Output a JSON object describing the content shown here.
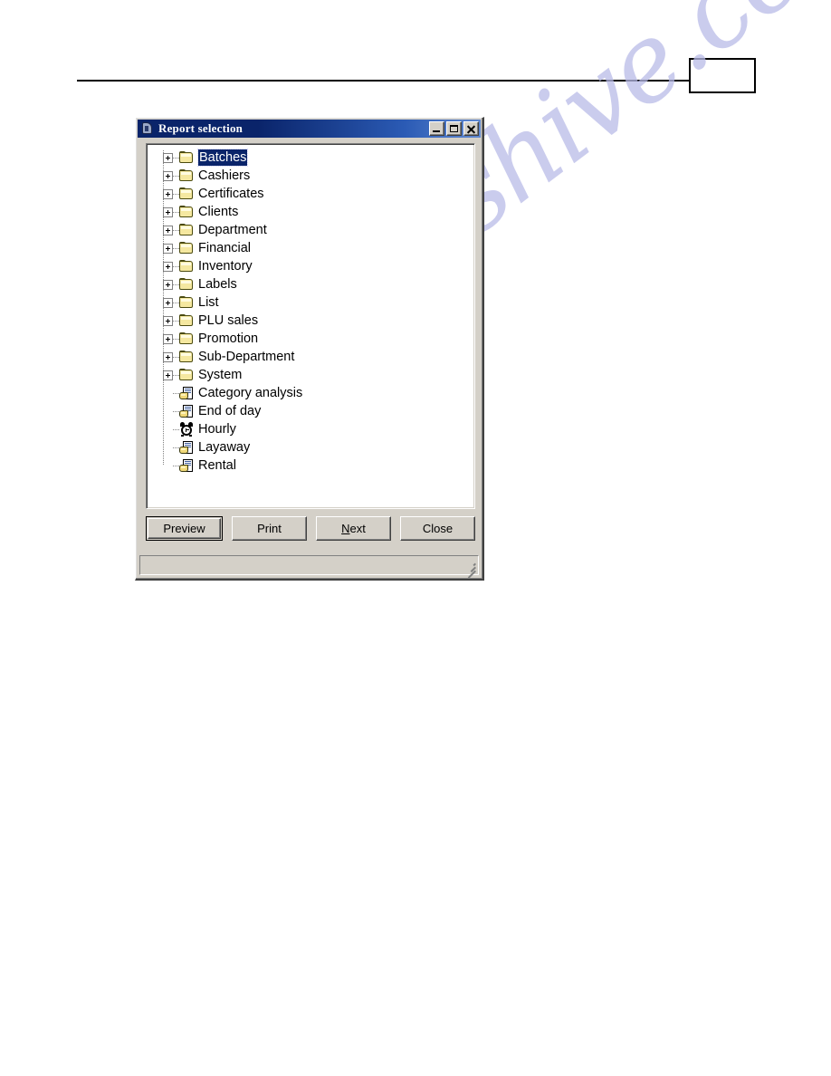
{
  "page": {
    "page_number_box_text": "",
    "watermark": "manualshive.com"
  },
  "dialog": {
    "title": "Report selection",
    "title_icon": "app-icon",
    "window_controls": [
      {
        "name": "minimize",
        "icon": "minimize-icon"
      },
      {
        "name": "maximize",
        "icon": "maximize-icon"
      },
      {
        "name": "close",
        "icon": "close-icon"
      }
    ],
    "tree": {
      "selected": "Batches",
      "nodes": [
        {
          "label": "Batches",
          "type": "folder",
          "expandable": true,
          "icon": "folder-icon",
          "selected": true
        },
        {
          "label": "Cashiers",
          "type": "folder",
          "expandable": true,
          "icon": "folder-icon",
          "selected": false
        },
        {
          "label": "Certificates",
          "type": "folder",
          "expandable": true,
          "icon": "folder-icon",
          "selected": false
        },
        {
          "label": "Clients",
          "type": "folder",
          "expandable": true,
          "icon": "folder-icon",
          "selected": false
        },
        {
          "label": "Department",
          "type": "folder",
          "expandable": true,
          "icon": "folder-icon",
          "selected": false
        },
        {
          "label": "Financial",
          "type": "folder",
          "expandable": true,
          "icon": "folder-icon",
          "selected": false
        },
        {
          "label": "Inventory",
          "type": "folder",
          "expandable": true,
          "icon": "folder-icon",
          "selected": false
        },
        {
          "label": "Labels",
          "type": "folder",
          "expandable": true,
          "icon": "folder-icon",
          "selected": false
        },
        {
          "label": "List",
          "type": "folder",
          "expandable": true,
          "icon": "folder-icon",
          "selected": false
        },
        {
          "label": "PLU sales",
          "type": "folder",
          "expandable": true,
          "icon": "folder-icon",
          "selected": false
        },
        {
          "label": "Promotion",
          "type": "folder",
          "expandable": true,
          "icon": "folder-icon",
          "selected": false
        },
        {
          "label": "Sub-Department",
          "type": "folder",
          "expandable": true,
          "icon": "folder-icon",
          "selected": false
        },
        {
          "label": "System",
          "type": "folder",
          "expandable": true,
          "icon": "folder-icon",
          "selected": false
        },
        {
          "label": "Category analysis",
          "type": "report",
          "expandable": false,
          "icon": "report-icon",
          "selected": false
        },
        {
          "label": "End of day",
          "type": "report",
          "expandable": false,
          "icon": "report-icon",
          "selected": false
        },
        {
          "label": "Hourly",
          "type": "clock",
          "expandable": false,
          "icon": "alarm-clock-icon",
          "selected": false
        },
        {
          "label": "Layaway",
          "type": "report",
          "expandable": false,
          "icon": "report-icon",
          "selected": false
        },
        {
          "label": "Rental",
          "type": "report",
          "expandable": false,
          "icon": "report-icon",
          "selected": false
        }
      ]
    },
    "buttons": [
      {
        "label": "Preview",
        "default": true,
        "mnemonic": ""
      },
      {
        "label": "Print",
        "default": false,
        "mnemonic": ""
      },
      {
        "label": "Next",
        "default": false,
        "mnemonic": "N"
      },
      {
        "label": "Close",
        "default": false,
        "mnemonic": ""
      }
    ],
    "statusbar": {
      "text": "",
      "grip": "resize-grip"
    }
  },
  "colors": {
    "titlebar_start": "#0a246a",
    "titlebar_end": "#5f88d0",
    "dialog_face": "#d4d0c8",
    "selection": "#0a246a",
    "folder": "#f5e8a0",
    "watermark": "#b9bbe8"
  }
}
